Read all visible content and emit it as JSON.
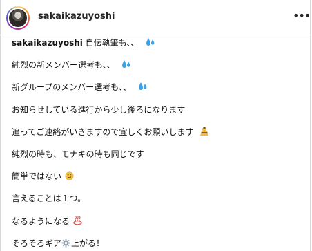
{
  "header": {
    "username": "sakaikazuyoshi",
    "more_glyph": "•••"
  },
  "caption": {
    "author": "sakaikazuyoshi",
    "lines": [
      "自伝執筆も、、",
      "純烈の新メンバー選考も、、",
      "新グループのメンバー選考も、、",
      "お知らせしている進行から少し後ろになります",
      "追ってご連絡がいきますので宜しくお願いします",
      "純烈の時も、モナキの時も同じです",
      "簡単ではない",
      "言えることは１つ。",
      "なるようになる",
      "そろそろギア",
      "上がる！"
    ]
  },
  "icons": {
    "sweat": "sweat-droplets-icon",
    "bow": "bowing-person-icon",
    "smile": "smiling-face-icon",
    "hotspring": "hot-springs-icon",
    "gear": "gear-icon"
  },
  "colors": {
    "text": "#111111",
    "sweat": "#3aa0e8",
    "divider": "#ececec"
  }
}
